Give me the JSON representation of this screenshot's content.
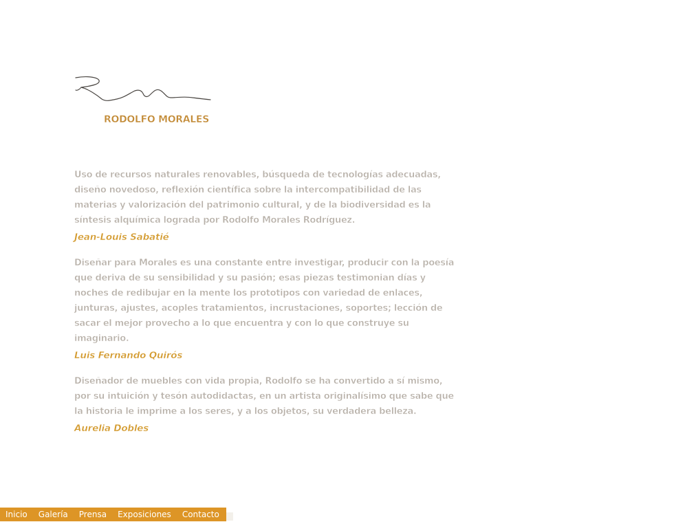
{
  "logo": {
    "name": "RODOLFO MORALES",
    "signature_icon": "handwritten-signature",
    "color": "#c28a35"
  },
  "quotes": [
    {
      "text": "Uso de recursos naturales renovables, búsqueda de tecnologías adecuadas, diseño novedoso, reflexión científica sobre la intercompatibilidad de las materias y valorización del patrimonio cultural, y de la biodiversidad es la síntesis alquímica lograda por Rodolfo Morales Rodríguez.",
      "author": "Jean-Louis Sabatié"
    },
    {
      "text": "Diseñar para Morales es una constante entre investigar, producir con la poesía que deriva de su sensibilidad y su pasión; esas piezas testimonian días y noches de redibujar en la mente los prototipos con variedad de enlaces, junturas, ajustes, acoples tratamientos, incrustaciones, soportes; lección de sacar el mejor provecho a lo que encuentra y con lo que construye su imaginario.",
      "author": "Luis Fernando Quirós"
    },
    {
      "text": "Diseñador de muebles con vida propia, Rodolfo se ha convertido a sí mismo, por su intuición y tesón autodidactas, en un artista originalísimo que sabe que la historia le imprime a los seres, y a los objetos, su verdadera belleza.",
      "author": "Aurelia Dobles"
    }
  ],
  "menu": {
    "items": [
      "Inicio",
      "Galería",
      "Prensa",
      "Exposiciones",
      "Contacto"
    ],
    "background": "#dd9526"
  },
  "colors": {
    "quote_text": "#b7b0a8",
    "author": "#d39a2e"
  }
}
